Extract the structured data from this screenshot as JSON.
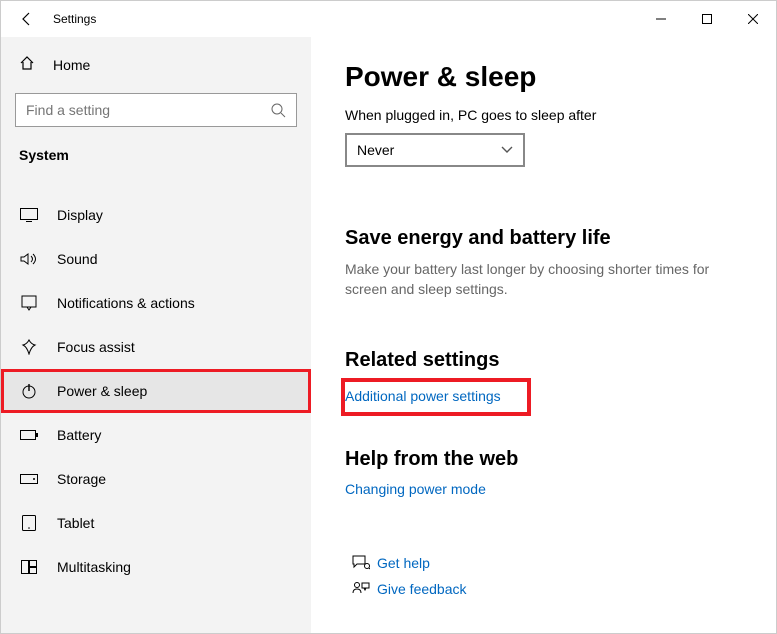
{
  "window": {
    "title": "Settings"
  },
  "sidebar": {
    "home": "Home",
    "search_placeholder": "Find a setting",
    "section": "System",
    "items": [
      {
        "label": "Display"
      },
      {
        "label": "Sound"
      },
      {
        "label": "Notifications & actions"
      },
      {
        "label": "Focus assist"
      },
      {
        "label": "Power & sleep"
      },
      {
        "label": "Battery"
      },
      {
        "label": "Storage"
      },
      {
        "label": "Tablet"
      },
      {
        "label": "Multitasking"
      }
    ]
  },
  "content": {
    "title": "Power & sleep",
    "plugged_label": "When plugged in, PC goes to sleep after",
    "sleep_value": "Never",
    "energy_heading": "Save energy and battery life",
    "energy_desc": "Make your battery last longer by choosing shorter times for screen and sleep settings.",
    "related_heading": "Related settings",
    "additional_link": "Additional power settings",
    "help_heading": "Help from the web",
    "changing_link": "Changing power mode",
    "get_help": "Get help",
    "give_feedback": "Give feedback"
  }
}
